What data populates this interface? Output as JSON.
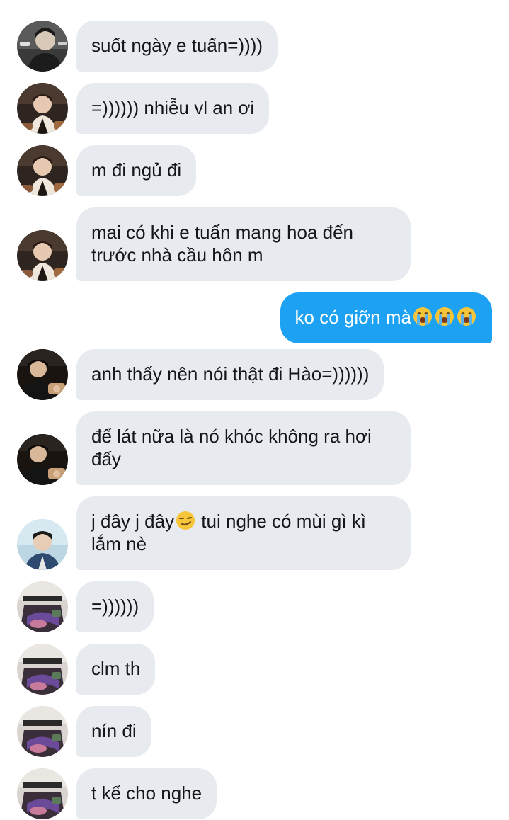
{
  "messages": [
    {
      "text": "suốt ngày e tuấn=))))",
      "avatar": "avatar-user-1"
    },
    {
      "text": "=)))))) nhiễu vl an ơi",
      "avatar": "avatar-user-2"
    },
    {
      "text": "m đi ngủ đi",
      "avatar": "avatar-user-2"
    },
    {
      "text": "mai có khi e tuấn mang hoa đến\ntrước nhà cầu hôn m",
      "avatar": "avatar-user-2"
    },
    {
      "text": "ko có giỡn mà",
      "emoji": "loudly-crying-face-icon",
      "outgoing": true
    },
    {
      "text": "anh thấy nên nói thật đi Hào=))))))",
      "avatar": "avatar-user-3"
    },
    {
      "text": "để lát nữa là nó khóc không ra hơi\nđấy",
      "avatar": "avatar-user-3"
    },
    {
      "text_before": "j đây j đây",
      "emoji": "smirking-face-icon",
      "text_after": " tui nghe có mùi gì kì\nlắm nè",
      "avatar": "avatar-user-4"
    },
    {
      "text": "=))))))",
      "avatar": "avatar-user-5"
    },
    {
      "text": "clm th",
      "avatar": "avatar-user-5"
    },
    {
      "text": "nín đi",
      "avatar": "avatar-user-5"
    },
    {
      "text": "t kể cho nghe",
      "avatar": "avatar-user-5"
    }
  ],
  "colors": {
    "incoming_bubble": "#e7eaee",
    "outgoing_bubble": "#1da1f2",
    "incoming_text": "#14171a",
    "outgoing_text": "#ffffff"
  }
}
